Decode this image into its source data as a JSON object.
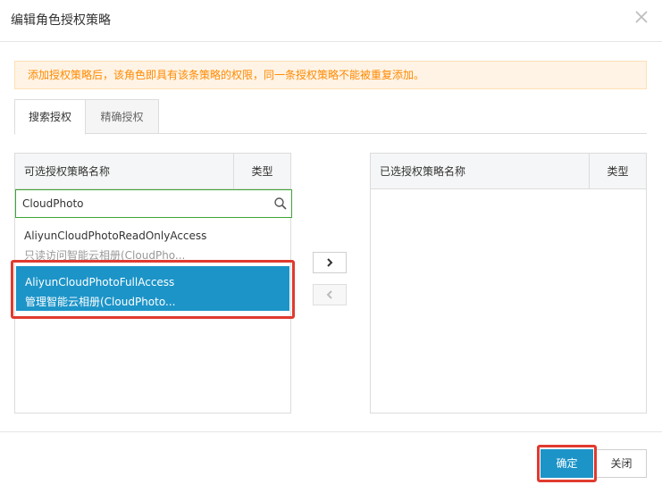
{
  "dialog": {
    "title": "编辑角色授权策略",
    "close_icon": "close-icon"
  },
  "notice": "添加授权策略后，该角色即具有该条策略的权限，同一条授权策略不能被重复添加。",
  "tabs": [
    {
      "label": "搜索授权",
      "active": true
    },
    {
      "label": "精确授权",
      "active": false
    }
  ],
  "left_panel": {
    "col_name": "可选授权策略名称",
    "col_type": "类型",
    "search_value": "CloudPhoto",
    "search_icon": "search-icon",
    "items": [
      {
        "name": "AliyunCloudPhotoReadOnlyAccess",
        "desc": "只读访问智能云相册(CloudPho...",
        "selected": false
      },
      {
        "name": "AliyunCloudPhotoFullAccess",
        "desc": "管理智能云相册(CloudPhoto...",
        "selected": true
      }
    ]
  },
  "right_panel": {
    "col_name": "已选授权策略名称",
    "col_type": "类型"
  },
  "transfer": {
    "add_icon": "chevron-right-icon",
    "remove_icon": "chevron-left-icon"
  },
  "footer": {
    "ok_label": "确定",
    "cancel_label": "关闭"
  },
  "colors": {
    "accent": "#1c94c8",
    "highlight": "#e03a2f",
    "notice_text": "#ff8a00",
    "notice_bg": "#fff3e5",
    "search_border": "#3ea535"
  }
}
